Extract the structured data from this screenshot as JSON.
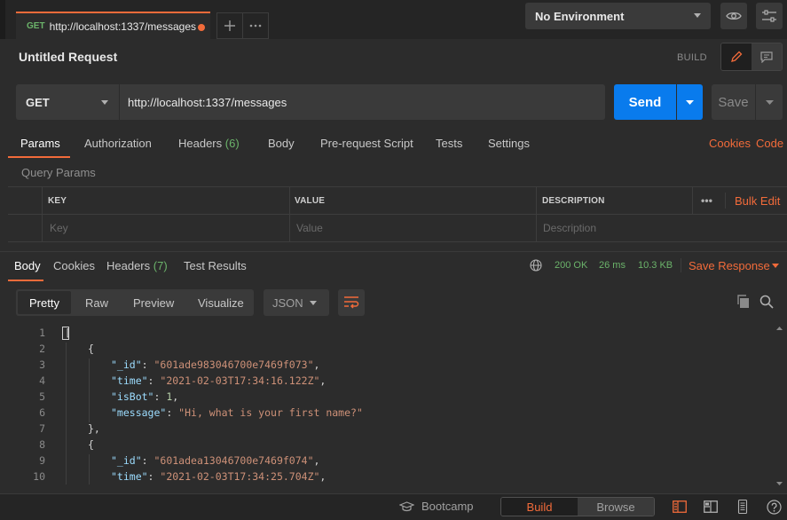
{
  "tab": {
    "method": "GET",
    "url": "http://localhost:1337/messages",
    "unsaved": true
  },
  "tabstrip": {
    "new_tab_icon": "plus-icon",
    "more_icon": "ellipsis-icon"
  },
  "environment": {
    "selected": "No Environment"
  },
  "request": {
    "title": "Untitled Request",
    "build_label": "BUILD",
    "method": "GET",
    "url": "http://localhost:1337/messages",
    "send_label": "Send",
    "save_label": "Save"
  },
  "request_tabs": {
    "params": "Params",
    "authorization": "Authorization",
    "headers": "Headers",
    "headers_count": "(6)",
    "body": "Body",
    "pre_request": "Pre-request Script",
    "tests": "Tests",
    "settings": "Settings",
    "cookies": "Cookies",
    "code": "Code"
  },
  "query_params": {
    "title": "Query Params",
    "columns": {
      "key": "KEY",
      "value": "VALUE",
      "description": "DESCRIPTION"
    },
    "more": "•••",
    "bulk_edit": "Bulk Edit",
    "placeholders": {
      "key": "Key",
      "value": "Value",
      "description": "Description"
    }
  },
  "response": {
    "tabs": {
      "body": "Body",
      "cookies": "Cookies",
      "headers": "Headers",
      "headers_count": "(7)",
      "test_results": "Test Results"
    },
    "status": "200 OK",
    "time": "26 ms",
    "size": "10.3 KB",
    "save_response": "Save Response",
    "views": {
      "pretty": "Pretty",
      "raw": "Raw",
      "preview": "Preview",
      "visualize": "Visualize"
    },
    "format": "JSON"
  },
  "code_lines": [
    {
      "num": "1",
      "text": "["
    },
    {
      "num": "2",
      "text": "{"
    },
    {
      "num": "3",
      "key": "\"_id\"",
      "value": "\"601ade983046700e7469f073\"",
      "trail": ","
    },
    {
      "num": "4",
      "key": "\"time\"",
      "value": "\"2021-02-03T17:34:16.122Z\"",
      "trail": ","
    },
    {
      "num": "5",
      "key": "\"isBot\"",
      "value": "1",
      "trail": ","
    },
    {
      "num": "6",
      "key": "\"message\"",
      "value": "\"Hi, what is your first name?\"",
      "trail": ""
    },
    {
      "num": "7",
      "text": "},"
    },
    {
      "num": "8",
      "text": "{"
    },
    {
      "num": "9",
      "key": "\"_id\"",
      "value": "\"601adea13046700e7469f074\"",
      "trail": ","
    },
    {
      "num": "10",
      "key": "\"time\"",
      "value": "\"2021-02-03T17:34:25.704Z\"",
      "trail": ","
    }
  ],
  "statusbar": {
    "bootcamp": "Bootcamp",
    "build": "Build",
    "browse": "Browse"
  },
  "colors": {
    "accent": "#f26b3a",
    "send": "#097bed",
    "success": "#6bb36a"
  }
}
